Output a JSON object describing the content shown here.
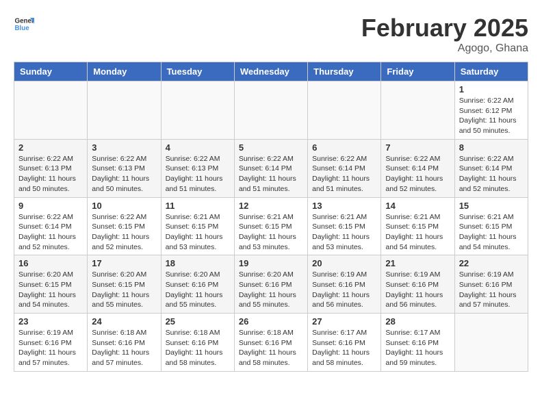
{
  "logo": {
    "general": "General",
    "blue": "Blue"
  },
  "title": "February 2025",
  "location": "Agogo, Ghana",
  "days_of_week": [
    "Sunday",
    "Monday",
    "Tuesday",
    "Wednesday",
    "Thursday",
    "Friday",
    "Saturday"
  ],
  "weeks": [
    [
      {
        "day": "",
        "info": ""
      },
      {
        "day": "",
        "info": ""
      },
      {
        "day": "",
        "info": ""
      },
      {
        "day": "",
        "info": ""
      },
      {
        "day": "",
        "info": ""
      },
      {
        "day": "",
        "info": ""
      },
      {
        "day": "1",
        "info": "Sunrise: 6:22 AM\nSunset: 6:12 PM\nDaylight: 11 hours and 50 minutes."
      }
    ],
    [
      {
        "day": "2",
        "info": "Sunrise: 6:22 AM\nSunset: 6:13 PM\nDaylight: 11 hours and 50 minutes."
      },
      {
        "day": "3",
        "info": "Sunrise: 6:22 AM\nSunset: 6:13 PM\nDaylight: 11 hours and 50 minutes."
      },
      {
        "day": "4",
        "info": "Sunrise: 6:22 AM\nSunset: 6:13 PM\nDaylight: 11 hours and 51 minutes."
      },
      {
        "day": "5",
        "info": "Sunrise: 6:22 AM\nSunset: 6:14 PM\nDaylight: 11 hours and 51 minutes."
      },
      {
        "day": "6",
        "info": "Sunrise: 6:22 AM\nSunset: 6:14 PM\nDaylight: 11 hours and 51 minutes."
      },
      {
        "day": "7",
        "info": "Sunrise: 6:22 AM\nSunset: 6:14 PM\nDaylight: 11 hours and 52 minutes."
      },
      {
        "day": "8",
        "info": "Sunrise: 6:22 AM\nSunset: 6:14 PM\nDaylight: 11 hours and 52 minutes."
      }
    ],
    [
      {
        "day": "9",
        "info": "Sunrise: 6:22 AM\nSunset: 6:14 PM\nDaylight: 11 hours and 52 minutes."
      },
      {
        "day": "10",
        "info": "Sunrise: 6:22 AM\nSunset: 6:15 PM\nDaylight: 11 hours and 52 minutes."
      },
      {
        "day": "11",
        "info": "Sunrise: 6:21 AM\nSunset: 6:15 PM\nDaylight: 11 hours and 53 minutes."
      },
      {
        "day": "12",
        "info": "Sunrise: 6:21 AM\nSunset: 6:15 PM\nDaylight: 11 hours and 53 minutes."
      },
      {
        "day": "13",
        "info": "Sunrise: 6:21 AM\nSunset: 6:15 PM\nDaylight: 11 hours and 53 minutes."
      },
      {
        "day": "14",
        "info": "Sunrise: 6:21 AM\nSunset: 6:15 PM\nDaylight: 11 hours and 54 minutes."
      },
      {
        "day": "15",
        "info": "Sunrise: 6:21 AM\nSunset: 6:15 PM\nDaylight: 11 hours and 54 minutes."
      }
    ],
    [
      {
        "day": "16",
        "info": "Sunrise: 6:20 AM\nSunset: 6:15 PM\nDaylight: 11 hours and 54 minutes."
      },
      {
        "day": "17",
        "info": "Sunrise: 6:20 AM\nSunset: 6:15 PM\nDaylight: 11 hours and 55 minutes."
      },
      {
        "day": "18",
        "info": "Sunrise: 6:20 AM\nSunset: 6:16 PM\nDaylight: 11 hours and 55 minutes."
      },
      {
        "day": "19",
        "info": "Sunrise: 6:20 AM\nSunset: 6:16 PM\nDaylight: 11 hours and 55 minutes."
      },
      {
        "day": "20",
        "info": "Sunrise: 6:19 AM\nSunset: 6:16 PM\nDaylight: 11 hours and 56 minutes."
      },
      {
        "day": "21",
        "info": "Sunrise: 6:19 AM\nSunset: 6:16 PM\nDaylight: 11 hours and 56 minutes."
      },
      {
        "day": "22",
        "info": "Sunrise: 6:19 AM\nSunset: 6:16 PM\nDaylight: 11 hours and 57 minutes."
      }
    ],
    [
      {
        "day": "23",
        "info": "Sunrise: 6:19 AM\nSunset: 6:16 PM\nDaylight: 11 hours and 57 minutes."
      },
      {
        "day": "24",
        "info": "Sunrise: 6:18 AM\nSunset: 6:16 PM\nDaylight: 11 hours and 57 minutes."
      },
      {
        "day": "25",
        "info": "Sunrise: 6:18 AM\nSunset: 6:16 PM\nDaylight: 11 hours and 58 minutes."
      },
      {
        "day": "26",
        "info": "Sunrise: 6:18 AM\nSunset: 6:16 PM\nDaylight: 11 hours and 58 minutes."
      },
      {
        "day": "27",
        "info": "Sunrise: 6:17 AM\nSunset: 6:16 PM\nDaylight: 11 hours and 58 minutes."
      },
      {
        "day": "28",
        "info": "Sunrise: 6:17 AM\nSunset: 6:16 PM\nDaylight: 11 hours and 59 minutes."
      },
      {
        "day": "",
        "info": ""
      }
    ]
  ]
}
